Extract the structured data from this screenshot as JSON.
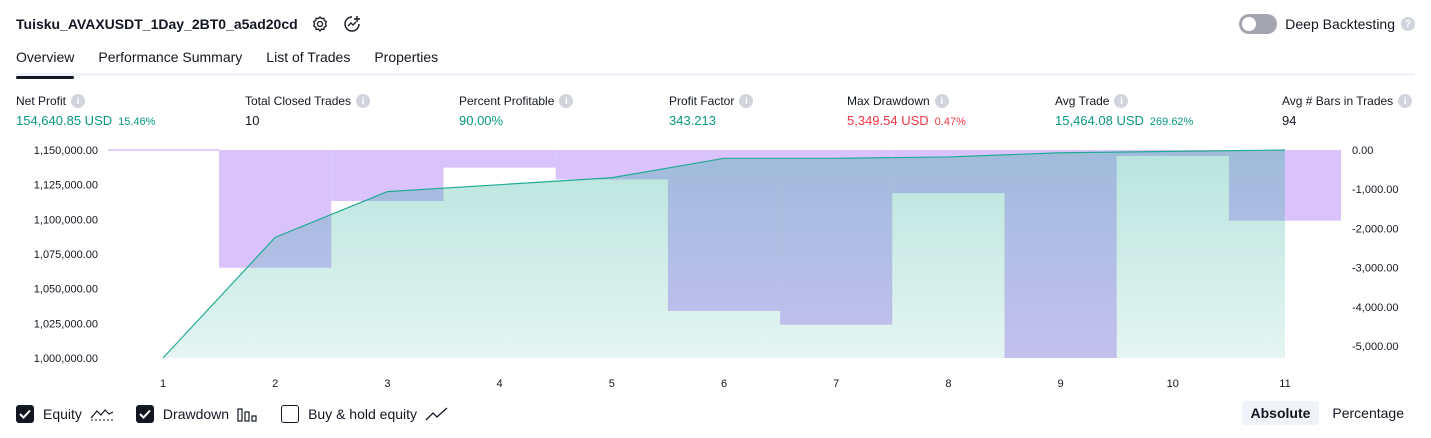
{
  "header": {
    "strategy_name": "Tuisku_AVAXUSDT_1Day_2BT0_a5ad20cd",
    "deep_backtesting_label": "Deep Backtesting",
    "deep_backtesting_on": false
  },
  "tabs": [
    {
      "label": "Overview",
      "active": true
    },
    {
      "label": "Performance Summary",
      "active": false
    },
    {
      "label": "List of Trades",
      "active": false
    },
    {
      "label": "Properties",
      "active": false
    }
  ],
  "metrics": {
    "net_profit": {
      "label": "Net Profit",
      "value": "154,640.85 USD",
      "pct": "15.46%"
    },
    "total_closed_trades": {
      "label": "Total Closed Trades",
      "value": "10"
    },
    "percent_profitable": {
      "label": "Percent Profitable",
      "value": "90.00%"
    },
    "profit_factor": {
      "label": "Profit Factor",
      "value": "343.213"
    },
    "max_drawdown": {
      "label": "Max Drawdown",
      "value": "5,349.54 USD",
      "pct": "0.47%"
    },
    "avg_trade": {
      "label": "Avg Trade",
      "value": "15,464.08 USD",
      "pct": "269.62%"
    },
    "avg_bars": {
      "label": "Avg # Bars in Trades",
      "value": "94"
    }
  },
  "colors": {
    "green": "#089981",
    "red": "#f23645",
    "equity_line": "#22ab94",
    "drawdown_fill": "#c49ef8"
  },
  "chart_data": {
    "type": "area",
    "x": [
      1,
      2,
      3,
      4,
      5,
      6,
      7,
      8,
      9,
      10,
      11
    ],
    "y_left_ticks": [
      "1,150,000.00",
      "1,125,000.00",
      "1,100,000.00",
      "1,075,000.00",
      "1,050,000.00",
      "1,025,000.00",
      "1,000,000.00"
    ],
    "y_right_ticks": [
      "0.00",
      "-1,000.00",
      "-2,000.00",
      "-3,000.00",
      "-4,000.00",
      "-5,000.00"
    ],
    "ylim_left": [
      1000000,
      1150000
    ],
    "ylim_right": [
      -5300,
      0
    ],
    "series": [
      {
        "name": "Equity",
        "axis": "left",
        "values": [
          1000000,
          1087000,
          1120000,
          1125000,
          1130000,
          1144000,
          1144000,
          1145000,
          1148000,
          1149000,
          1150000
        ]
      },
      {
        "name": "Drawdown",
        "axis": "right",
        "values": [
          0,
          -3000,
          -1300,
          -450,
          -750,
          -4100,
          -4450,
          -1100,
          -5300,
          -150,
          -1800
        ]
      }
    ]
  },
  "legend": [
    {
      "label": "Equity",
      "checked": true,
      "icon": "equity-icon"
    },
    {
      "label": "Drawdown",
      "checked": true,
      "icon": "drawdown-icon"
    },
    {
      "label": "Buy & hold equity",
      "checked": false,
      "icon": "buy-hold-icon"
    }
  ],
  "mode": {
    "absolute": "Absolute",
    "percentage": "Percentage",
    "active": "absolute"
  }
}
